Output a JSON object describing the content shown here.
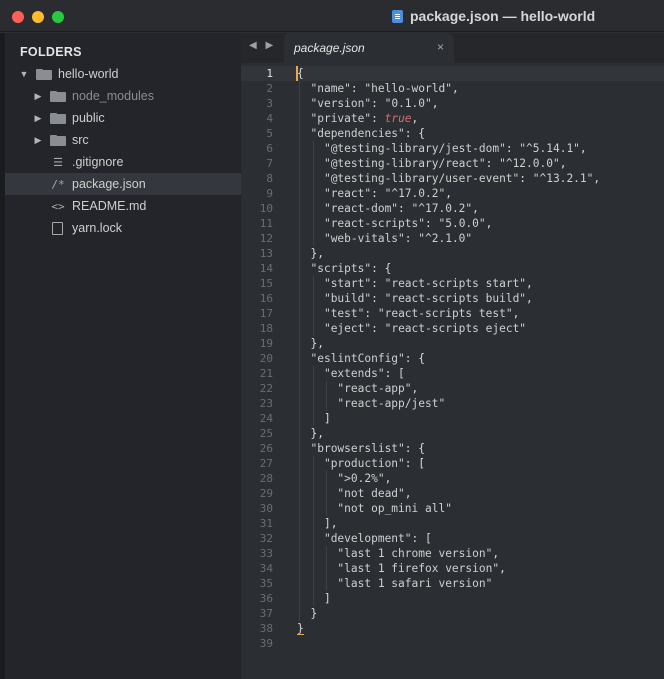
{
  "window": {
    "title": "package.json — hello-world"
  },
  "sidebar": {
    "heading": "FOLDERS",
    "items": [
      {
        "label": "hello-world",
        "kind": "folder-open",
        "depth": 0,
        "disclosure": "▼"
      },
      {
        "label": "node_modules",
        "kind": "folder",
        "depth": 1,
        "disclosure": "▶",
        "dim": true
      },
      {
        "label": "public",
        "kind": "folder",
        "depth": 1,
        "disclosure": "▶"
      },
      {
        "label": "src",
        "kind": "folder",
        "depth": 1,
        "disclosure": "▶"
      },
      {
        "label": ".gitignore",
        "kind": "file",
        "depth": 1,
        "icon": "list-icon",
        "glyph": "☰"
      },
      {
        "label": "package.json",
        "kind": "file",
        "depth": 1,
        "icon": "comment-icon",
        "glyph": "/*",
        "selected": true
      },
      {
        "label": "README.md",
        "kind": "file",
        "depth": 1,
        "icon": "code-icon",
        "glyph": "<>"
      },
      {
        "label": "yarn.lock",
        "kind": "file",
        "depth": 1,
        "icon": "document-icon",
        "glyph": ""
      }
    ]
  },
  "tabs": [
    {
      "label": "package.json",
      "active": true,
      "close": "×"
    }
  ],
  "nav": {
    "arrows": "◀ ▶"
  },
  "editor": {
    "current_line": 1,
    "lines": [
      [
        [
          "{",
          "punc"
        ]
      ],
      [
        [
          "  ",
          "ws"
        ],
        [
          "\"name\"",
          "key"
        ],
        [
          ": ",
          "punc"
        ],
        [
          "\"hello-world\"",
          "str"
        ],
        [
          ",",
          "punc"
        ]
      ],
      [
        [
          "  ",
          "ws"
        ],
        [
          "\"version\"",
          "key"
        ],
        [
          ": ",
          "punc"
        ],
        [
          "\"0.1.0\"",
          "str"
        ],
        [
          ",",
          "punc"
        ]
      ],
      [
        [
          "  ",
          "ws"
        ],
        [
          "\"private\"",
          "key"
        ],
        [
          ": ",
          "punc"
        ],
        [
          "true",
          "bool"
        ],
        [
          ",",
          "punc"
        ]
      ],
      [
        [
          "  ",
          "ws"
        ],
        [
          "\"dependencies\"",
          "key"
        ],
        [
          ": {",
          "punc"
        ]
      ],
      [
        [
          "    ",
          "ws"
        ],
        [
          "\"@testing-library/jest-dom\"",
          "key"
        ],
        [
          ": ",
          "punc"
        ],
        [
          "\"^5.14.1\"",
          "str"
        ],
        [
          ",",
          "punc"
        ]
      ],
      [
        [
          "    ",
          "ws"
        ],
        [
          "\"@testing-library/react\"",
          "key"
        ],
        [
          ": ",
          "punc"
        ],
        [
          "\"^12.0.0\"",
          "str"
        ],
        [
          ",",
          "punc"
        ]
      ],
      [
        [
          "    ",
          "ws"
        ],
        [
          "\"@testing-library/user-event\"",
          "key"
        ],
        [
          ": ",
          "punc"
        ],
        [
          "\"^13.2.1\"",
          "str"
        ],
        [
          ",",
          "punc"
        ]
      ],
      [
        [
          "    ",
          "ws"
        ],
        [
          "\"react\"",
          "key"
        ],
        [
          ": ",
          "punc"
        ],
        [
          "\"^17.0.2\"",
          "str"
        ],
        [
          ",",
          "punc"
        ]
      ],
      [
        [
          "    ",
          "ws"
        ],
        [
          "\"react-dom\"",
          "key"
        ],
        [
          ": ",
          "punc"
        ],
        [
          "\"^17.0.2\"",
          "str"
        ],
        [
          ",",
          "punc"
        ]
      ],
      [
        [
          "    ",
          "ws"
        ],
        [
          "\"react-scripts\"",
          "key"
        ],
        [
          ": ",
          "punc"
        ],
        [
          "\"5.0.0\"",
          "str"
        ],
        [
          ",",
          "punc"
        ]
      ],
      [
        [
          "    ",
          "ws"
        ],
        [
          "\"web-vitals\"",
          "key"
        ],
        [
          ": ",
          "punc"
        ],
        [
          "\"^2.1.0\"",
          "str"
        ]
      ],
      [
        [
          "  ",
          "ws"
        ],
        [
          "},",
          "punc"
        ]
      ],
      [
        [
          "  ",
          "ws"
        ],
        [
          "\"scripts\"",
          "key"
        ],
        [
          ": {",
          "punc"
        ]
      ],
      [
        [
          "    ",
          "ws"
        ],
        [
          "\"start\"",
          "key"
        ],
        [
          ": ",
          "punc"
        ],
        [
          "\"react-scripts start\"",
          "str"
        ],
        [
          ",",
          "punc"
        ]
      ],
      [
        [
          "    ",
          "ws"
        ],
        [
          "\"build\"",
          "key"
        ],
        [
          ": ",
          "punc"
        ],
        [
          "\"react-scripts build\"",
          "str"
        ],
        [
          ",",
          "punc"
        ]
      ],
      [
        [
          "    ",
          "ws"
        ],
        [
          "\"test\"",
          "key"
        ],
        [
          ": ",
          "punc"
        ],
        [
          "\"react-scripts test\"",
          "str"
        ],
        [
          ",",
          "punc"
        ]
      ],
      [
        [
          "    ",
          "ws"
        ],
        [
          "\"eject\"",
          "key"
        ],
        [
          ": ",
          "punc"
        ],
        [
          "\"react-scripts eject\"",
          "str"
        ]
      ],
      [
        [
          "  ",
          "ws"
        ],
        [
          "},",
          "punc"
        ]
      ],
      [
        [
          "  ",
          "ws"
        ],
        [
          "\"eslintConfig\"",
          "key"
        ],
        [
          ": {",
          "punc"
        ]
      ],
      [
        [
          "    ",
          "ws"
        ],
        [
          "\"extends\"",
          "key"
        ],
        [
          ": [",
          "punc"
        ]
      ],
      [
        [
          "      ",
          "ws"
        ],
        [
          "\"react-app\"",
          "str"
        ],
        [
          ",",
          "punc"
        ]
      ],
      [
        [
          "      ",
          "ws"
        ],
        [
          "\"react-app/jest\"",
          "str"
        ]
      ],
      [
        [
          "    ",
          "ws"
        ],
        [
          "]",
          "punc"
        ]
      ],
      [
        [
          "  ",
          "ws"
        ],
        [
          "},",
          "punc"
        ]
      ],
      [
        [
          "  ",
          "ws"
        ],
        [
          "\"browserslist\"",
          "key"
        ],
        [
          ": {",
          "punc"
        ]
      ],
      [
        [
          "    ",
          "ws"
        ],
        [
          "\"production\"",
          "key"
        ],
        [
          ": [",
          "punc"
        ]
      ],
      [
        [
          "      ",
          "ws"
        ],
        [
          "\">0.2%\"",
          "str"
        ],
        [
          ",",
          "punc"
        ]
      ],
      [
        [
          "      ",
          "ws"
        ],
        [
          "\"not dead\"",
          "str"
        ],
        [
          ",",
          "punc"
        ]
      ],
      [
        [
          "      ",
          "ws"
        ],
        [
          "\"not op_mini all\"",
          "str"
        ]
      ],
      [
        [
          "    ",
          "ws"
        ],
        [
          "],",
          "punc"
        ]
      ],
      [
        [
          "    ",
          "ws"
        ],
        [
          "\"development\"",
          "key"
        ],
        [
          ": [",
          "punc"
        ]
      ],
      [
        [
          "      ",
          "ws"
        ],
        [
          "\"last 1 chrome version\"",
          "str"
        ],
        [
          ",",
          "punc"
        ]
      ],
      [
        [
          "      ",
          "ws"
        ],
        [
          "\"last 1 firefox version\"",
          "str"
        ],
        [
          ",",
          "punc"
        ]
      ],
      [
        [
          "      ",
          "ws"
        ],
        [
          "\"last 1 safari version\"",
          "str"
        ]
      ],
      [
        [
          "    ",
          "ws"
        ],
        [
          "]",
          "punc"
        ]
      ],
      [
        [
          "  ",
          "ws"
        ],
        [
          "}",
          "punc"
        ]
      ],
      [
        [
          "}",
          "punc"
        ]
      ],
      []
    ]
  },
  "colors": {
    "background": "#2b2e33",
    "sidebar": "#23252a",
    "selection": "#34373d",
    "cursor": "#e7a94a",
    "boolean": "#e06a6a",
    "close": "#fe5f57",
    "minimize": "#febc2e",
    "maximize": "#28c840"
  }
}
